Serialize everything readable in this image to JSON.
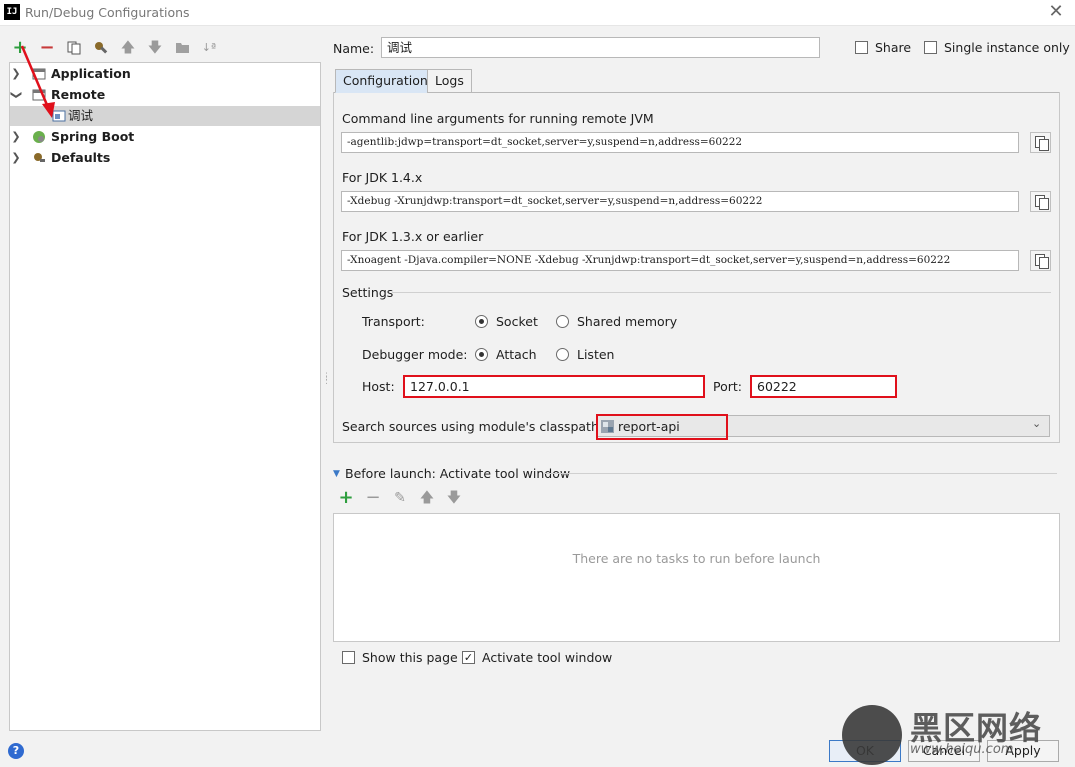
{
  "window": {
    "title": "Run/Debug Configurations",
    "app_icon_text": "IJ"
  },
  "tree": {
    "items": [
      {
        "label": "Application",
        "expanded": false,
        "level": 0,
        "icon": "application-icon"
      },
      {
        "label": "Remote",
        "expanded": true,
        "level": 0,
        "icon": "remote-icon"
      },
      {
        "label": "调试",
        "level": 1,
        "selected": true,
        "icon": "remote-config-icon"
      },
      {
        "label": "Spring Boot",
        "expanded": false,
        "level": 0,
        "icon": "spring-boot-icon"
      },
      {
        "label": "Defaults",
        "expanded": false,
        "level": 0,
        "icon": "defaults-icon"
      }
    ]
  },
  "name_field": {
    "label": "Name:",
    "value": "调试"
  },
  "share": {
    "label": "Share",
    "checked": false
  },
  "single_instance": {
    "label": "Single instance only",
    "checked": false
  },
  "tabs": [
    {
      "label": "Configuration",
      "active": true
    },
    {
      "label": "Logs",
      "active": false
    }
  ],
  "config": {
    "cmd_label": "Command line arguments for running remote JVM",
    "cmd_value": "-agentlib:jdwp=transport=dt_socket,server=y,suspend=n,address=60222",
    "jdk14_label": "For JDK 1.4.x",
    "jdk14_value": "-Xdebug -Xrunjdwp:transport=dt_socket,server=y,suspend=n,address=60222",
    "jdk13_label": "For JDK 1.3.x or earlier",
    "jdk13_value": "-Xnoagent -Djava.compiler=NONE -Xdebug -Xrunjdwp:transport=dt_socket,server=y,suspend=n,address=60222",
    "settings_label": "Settings",
    "transport_label": "Transport:",
    "transport_options": [
      {
        "label": "Socket",
        "selected": true
      },
      {
        "label": "Shared memory",
        "selected": false
      }
    ],
    "debugger_mode_label": "Debugger mode:",
    "debugger_mode_options": [
      {
        "label": "Attach",
        "selected": true
      },
      {
        "label": "Listen",
        "selected": false
      }
    ],
    "host_label": "Host:",
    "host_value": "127.0.0.1",
    "port_label": "Port:",
    "port_value": "60222",
    "classpath_label": "Search sources using module's classpath:",
    "classpath_value": "report-api"
  },
  "before_launch": {
    "label": "Before launch: Activate tool window",
    "empty_text": "There are no tasks to run before launch"
  },
  "show_page": {
    "label": "Show this page",
    "checked": false
  },
  "activate_tool_window": {
    "label": "Activate tool window",
    "checked": true
  },
  "buttons": {
    "ok": "OK",
    "cancel": "Cancel",
    "apply": "Apply"
  },
  "help_glyph": "?",
  "watermark": {
    "title": "黑区网络",
    "subtitle": "www.heiqu.com"
  },
  "colors": {
    "highlight_red": "#e0101b",
    "tab_active": "#d9e6f5",
    "add_green": "#2e9e3e",
    "remove_red": "#c73a3a"
  }
}
